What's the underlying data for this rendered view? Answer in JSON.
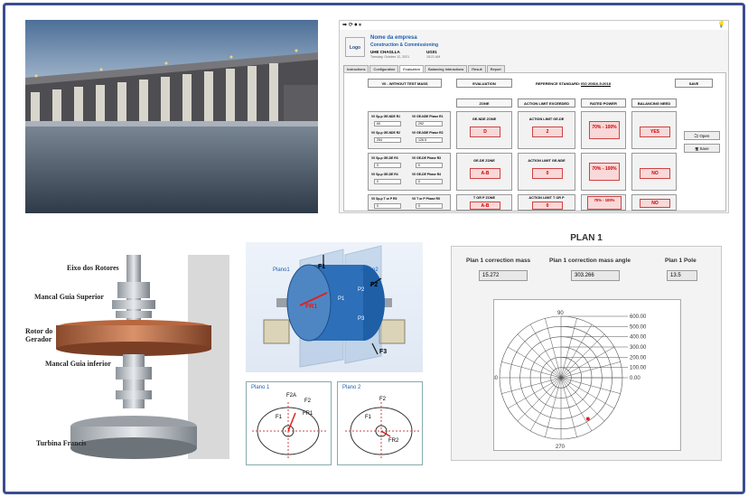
{
  "software": {
    "company_name": "Nome da empresa",
    "tagline": "Construction & Commissioning",
    "logo": "Logo",
    "plant": "UHE CHAGLLA",
    "date": "Tuesday, October 12, 2021",
    "unit": "UG01",
    "time": "15:21 AM",
    "tabs": [
      "Instructions",
      "Configuration",
      "Evaluation",
      "Balancing Interactions",
      "Result",
      "Report"
    ],
    "headers": {
      "without_test_mass": "V0 - WITHOUT TEST MASS",
      "evaluation": "EVALUATION",
      "reference_standard_label": "REFERENCE STANDARD:",
      "reference_standard": "ISO 20816-5:2018",
      "save": "SAVE",
      "zone": "ZONE",
      "action_limit": "ACTION LIMIT EXCEEDED",
      "rated_power": "RATED POWER",
      "balancing_need": "BALANCING NEED"
    },
    "inputs": [
      {
        "label": "V0 Sp-p GE-NDE R1",
        "value": "60"
      },
      {
        "label": "V0 GE-NDE Phase R1",
        "value": "292"
      },
      {
        "label": "V0 Sp-p GE-NDE R2",
        "value": "254"
      },
      {
        "label": "V0 GE-NDE Phase R2",
        "value": "126.5"
      },
      {
        "label": "V0 Sp-p GE-DE R3",
        "value": "0"
      },
      {
        "label": "V0 GE-DE Phase R3",
        "value": "0"
      },
      {
        "label": "V0 Sp-p GE-DE R4",
        "value": "0"
      },
      {
        "label": "V0 GE-DE Phase R4",
        "value": "0"
      },
      {
        "label": "V0 Sp-p T or P R5",
        "value": "0"
      },
      {
        "label": "V0 T or P Phase R5",
        "value": "0"
      }
    ],
    "rows": [
      {
        "zone_label": "GE-NDE ZONE",
        "zone": "D",
        "limit_label": "ACTION LIMIT GE-DE",
        "limit": "2",
        "power": "70% - 100%",
        "need": "YES"
      },
      {
        "zone_label": "GE-DE ZONE",
        "zone": "A-B",
        "limit_label": "ACTION LIMIT GE-NDE",
        "limit": "0",
        "power": "70% - 100%",
        "need": "NO"
      },
      {
        "zone_label": "T OR P ZONE",
        "zone": "A-B",
        "limit_label": "ACTION LIMIT T OR P",
        "limit": "0",
        "power": "70% - 100%",
        "need": "NO"
      }
    ],
    "open_label": "Open",
    "save_label": "Save"
  },
  "shaft_labels": {
    "shaft": "Eixo dos Rotores",
    "upper_bearing": "Mancal Guia Superior",
    "rotor": "Rotor do Gerador",
    "lower_bearing": "Mancal Guia inferior",
    "turbine": "Turbina Francis"
  },
  "rotor_diagram": {
    "plane1": "Plano1",
    "plane2": "Plano2",
    "f1": "F1",
    "f2": "F2",
    "f3": "F3",
    "fr1": "FR1",
    "p1": "P1",
    "p2": "P2",
    "p3": "P3",
    "plano1_title": "Plano 1",
    "plano2_title": "Plano 2",
    "p1_f2a": "F2A",
    "p1_f2": "F2",
    "p1_f1": "F1",
    "p1_fr1": "FR1",
    "p2_f2": "F2",
    "p2_f1": "F1",
    "p2_fr2": "FR2"
  },
  "plan1": {
    "title": "PLAN 1",
    "mass_label": "Plan 1 correction mass",
    "mass_value": "15.272",
    "angle_label": "Plan 1 correction mass angle",
    "angle_value": "303.266",
    "pole_label": "Plan 1 Pole",
    "pole_value": "13.5",
    "radial_ticks": [
      "600.00",
      "500.00",
      "400.00",
      "300.00",
      "200.00",
      "100.00",
      "0.00"
    ],
    "angle_ticks": [
      "90",
      "180",
      "270"
    ],
    "point_color": "#e02020"
  },
  "colors": {
    "frame": "#3a4d8f",
    "accent": "#1c5fb0",
    "alarm": "#c00000"
  }
}
